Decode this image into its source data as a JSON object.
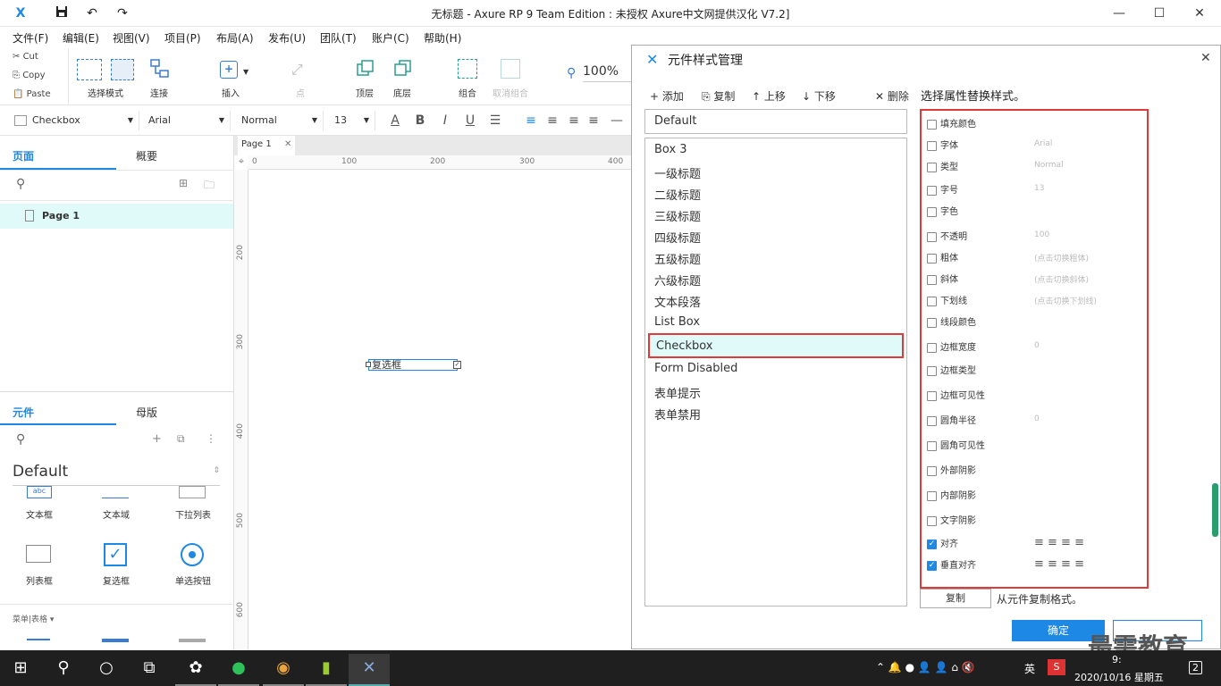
{
  "titlebar": {
    "title": "无标题 - Axure RP 9 Team Edition : 未授权    Axure中文网提供汉化 V7.2]",
    "logo": "X",
    "minimize": "—",
    "maximize": "☐",
    "close": "✕"
  },
  "menu": [
    "文件(F)",
    "编辑(E)",
    "视图(V)",
    "项目(P)",
    "布局(A)",
    "发布(U)",
    "团队(T)",
    "账户(C)",
    "帮助(H)"
  ],
  "clipboard": {
    "cut": "Cut",
    "copy": "Copy",
    "paste": "Paste"
  },
  "toolbar": {
    "select_mode": "选择模式",
    "connect": "连接",
    "insert": "插入",
    "point": "点",
    "top": "顶层",
    "bottom": "底层",
    "group": "组合",
    "ungroup": "取消组合",
    "zoom": "100%"
  },
  "format": {
    "style": "Checkbox",
    "font": "Arial",
    "weight": "Normal",
    "size": "13"
  },
  "left_panel": {
    "pages_tab": "页面",
    "outline_tab": "概要",
    "page_item": "Page 1",
    "widgets_tab": "元件",
    "masters_tab": "母版",
    "library": "Default",
    "widgets": [
      {
        "label": "文本框"
      },
      {
        "label": "文本域"
      },
      {
        "label": "下拉列表"
      },
      {
        "label": "列表框"
      },
      {
        "label": "复选框"
      },
      {
        "label": "单选按钮"
      }
    ],
    "section": "菜单|表格 ▾"
  },
  "canvas": {
    "tab": "Page 1",
    "checkbox_label": "复选框",
    "ruler_h": [
      "0",
      "100",
      "200",
      "300",
      "400"
    ],
    "ruler_v": [
      "200",
      "300",
      "400",
      "500",
      "600"
    ]
  },
  "dialog": {
    "title": "元件样式管理",
    "add": "添加",
    "copy": "复制",
    "up": "上移",
    "down": "下移",
    "delete": "删除",
    "hint": "选择属性替换样式。",
    "default": "Default",
    "styles": [
      "Box 3",
      "一级标题",
      "二级标题",
      "三级标题",
      "四级标题",
      "五级标题",
      "六级标题",
      "文本段落",
      "List Box",
      "Checkbox",
      "Form Disabled",
      "表单提示",
      "表单禁用"
    ],
    "selected_style": "Checkbox",
    "props": [
      {
        "label": "填充颜色",
        "value": ""
      },
      {
        "label": "字体",
        "value": "Arial"
      },
      {
        "label": "类型",
        "value": "Normal"
      },
      {
        "label": "字号",
        "value": "13"
      },
      {
        "label": "字色",
        "value": ""
      },
      {
        "label": "不透明",
        "value": "100"
      },
      {
        "label": "粗体",
        "value": "(点击切换粗体)"
      },
      {
        "label": "斜体",
        "value": "(点击切换斜体)"
      },
      {
        "label": "下划线",
        "value": "(点击切换下划线)"
      },
      {
        "label": "线段颜色",
        "value": ""
      },
      {
        "label": "边框宽度",
        "value": "0"
      },
      {
        "label": "边框类型",
        "value": ""
      },
      {
        "label": "边框可见性",
        "value": ""
      },
      {
        "label": "圆角半径",
        "value": "0"
      },
      {
        "label": "圆角可见性",
        "value": ""
      },
      {
        "label": "外部阴影",
        "value": ""
      },
      {
        "label": "内部阴影",
        "value": ""
      },
      {
        "label": "文字阴影",
        "value": ""
      },
      {
        "label": "对齐",
        "value": ""
      },
      {
        "label": "垂直对齐",
        "value": ""
      }
    ],
    "checked": [
      "对齐",
      "垂直对齐"
    ],
    "copy_button": "复制",
    "copy_hint": "从元件复制格式。",
    "ok": "确定",
    "watermark": "最需教育"
  },
  "taskbar": {
    "ime": "英",
    "datetime": "2020/10/16 星期五",
    "time": "9:",
    "notif": "2"
  },
  "colors": {
    "accent": "#1e88e5",
    "highlight": "#e03a3a",
    "selected_bg": "#e0fafa",
    "taskbar": "#1f1f1f"
  }
}
